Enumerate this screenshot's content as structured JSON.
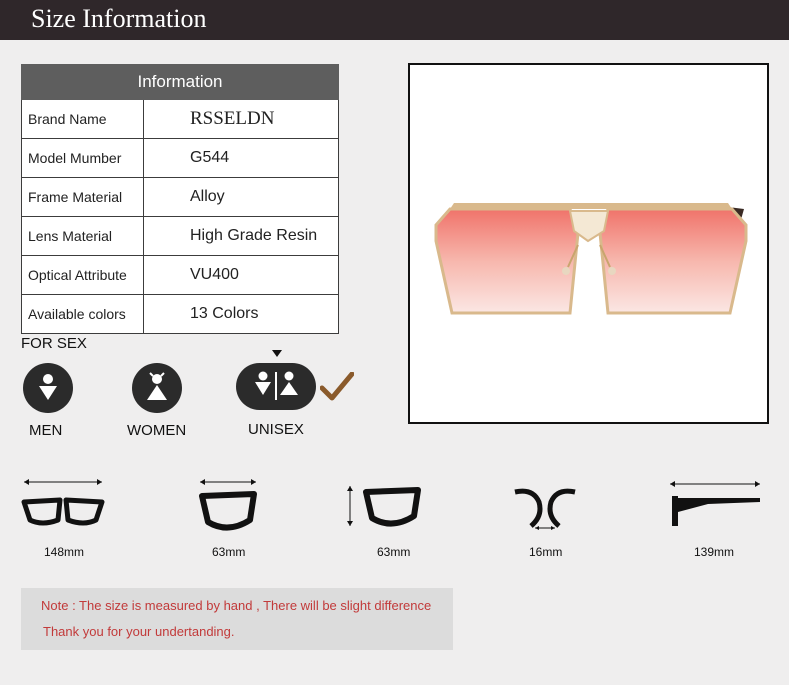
{
  "header": {
    "title": "Size Information"
  },
  "spec_table": {
    "heading": "Information",
    "rows": [
      {
        "key": "Brand Name",
        "value": "RSSELDN"
      },
      {
        "key": "Model Mumber",
        "value": "G544"
      },
      {
        "key": "Frame Material",
        "value": "Alloy"
      },
      {
        "key": "Lens Material",
        "value": "High Grade Resin"
      },
      {
        "key": "Optical Attribute",
        "value": "VU400"
      },
      {
        "key": "Available colors",
        "value": "13 Colors"
      }
    ]
  },
  "sex": {
    "title": "FOR SEX",
    "options": [
      {
        "label": "MEN",
        "icon": "man-icon"
      },
      {
        "label": "WOMEN",
        "icon": "woman-icon"
      },
      {
        "label": "UNISEX",
        "icon": "unisex-icon",
        "selected": true
      }
    ]
  },
  "measurements": [
    {
      "label": "148mm",
      "icon": "frame-width-icon"
    },
    {
      "label": "63mm",
      "icon": "lens-width-icon"
    },
    {
      "label": "63mm",
      "icon": "lens-height-icon"
    },
    {
      "label": "16mm",
      "icon": "bridge-width-icon"
    },
    {
      "label": "139mm",
      "icon": "temple-length-icon"
    }
  ],
  "note": {
    "line1": "Note : The size is measured by hand , There will be slight difference",
    "line2": "Thank you for your undertanding."
  },
  "colors": {
    "header_bg": "#2f272a",
    "table_heading_bg": "#5e5e5e",
    "note_text": "#c23a3a",
    "lens_top": "#f0736a",
    "lens_bottom": "#fbe7e4",
    "frame_gold": "#d9b98c",
    "check_brown": "#8a5a2b"
  }
}
